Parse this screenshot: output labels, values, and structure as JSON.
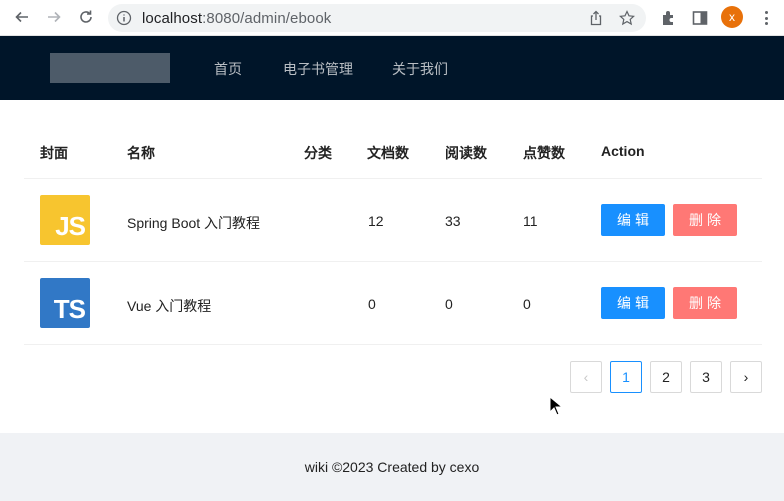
{
  "browser": {
    "url_host": "localhost",
    "url_rest": ":8080/admin/ebook",
    "profile_initial": "x"
  },
  "header": {
    "menu": [
      "首页",
      "电子书管理",
      "关于我们"
    ]
  },
  "table": {
    "columns": [
      "封面",
      "名称",
      "分类",
      "文档数",
      "阅读数",
      "点赞数",
      "Action"
    ],
    "rows": [
      {
        "cover": "JS",
        "name": "Spring Boot 入门教程",
        "category": "",
        "docs": "12",
        "views": "33",
        "likes": "11",
        "edit": "编辑",
        "delete": "删除"
      },
      {
        "cover": "TS",
        "name": "Vue 入门教程",
        "category": "",
        "docs": "0",
        "views": "0",
        "likes": "0",
        "edit": "编辑",
        "delete": "删除"
      }
    ]
  },
  "pagination": {
    "prev": "‹",
    "pages": [
      "1",
      "2",
      "3"
    ],
    "current": "1",
    "next": "›"
  },
  "footer": {
    "text": "wiki ©2023 Created by cexo"
  },
  "colors": {
    "header_bg": "#001529",
    "primary": "#1890ff",
    "danger": "#ff7875",
    "js_cover": "#f7c52f",
    "ts_cover": "#3178c6"
  }
}
